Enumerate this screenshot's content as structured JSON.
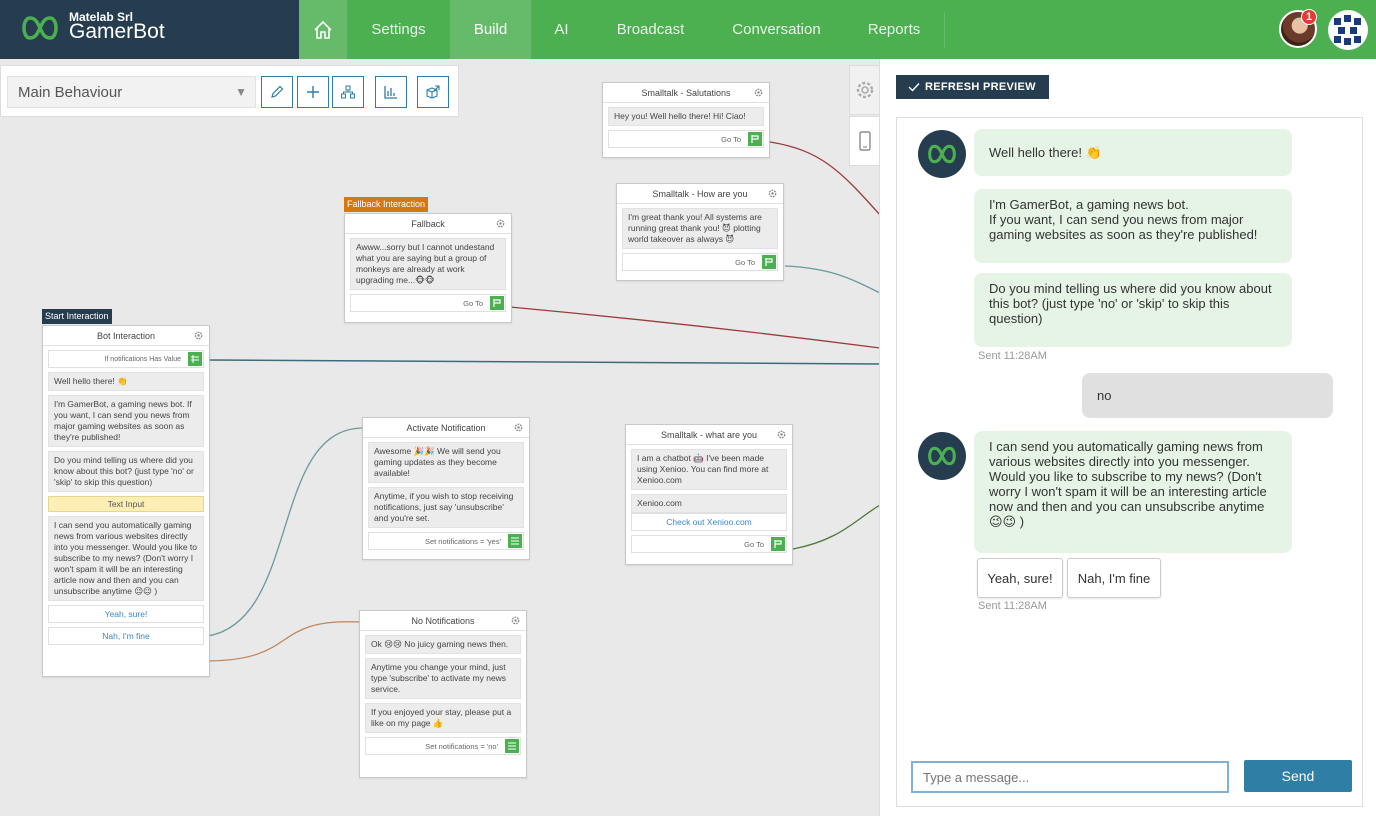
{
  "brand": {
    "company": "Matelab Srl",
    "name": "GamerBot"
  },
  "nav": {
    "items": [
      {
        "label": "Settings"
      },
      {
        "label": "Build"
      },
      {
        "label": "AI"
      },
      {
        "label": "Broadcast"
      },
      {
        "label": "Conversation"
      },
      {
        "label": "Reports"
      }
    ],
    "active": "Build",
    "notification_count": "1"
  },
  "toolbar": {
    "behaviour": "Main Behaviour"
  },
  "colors": {
    "accent_green": "#4caf50",
    "dark_navy": "#263d4f",
    "link_blue": "#2e7ea6"
  },
  "nodes": {
    "start": {
      "tag": "Start Interaction",
      "title": "Bot Interaction",
      "condition": "If notifications Has Value",
      "messages": [
        "Well hello there! 👏",
        "I'm GamerBot, a gaming news bot. If you want, I can send you news from major gaming websites as soon as they're published!",
        "Do you mind telling us where did you know about this bot? (just type 'no' or 'skip' to skip this question)"
      ],
      "text_input": "Text Input",
      "subscribe_message": "I can send you automatically gaming news from various websites directly into you messenger. Would you like to subscribe to my news? (Don't worry I won't spam it will be an interesting article now and then and you can unsubscribe anytime 😉😉 )",
      "button_yes": "Yeah, sure!",
      "button_no": "Nah, I'm fine"
    },
    "fallback": {
      "tag": "Fallback Interaction",
      "title": "Fallback",
      "message": "Awww...sorry but I cannot undestand what you are saying but a group of monkeys are already at work upgrading me...🐵🐵",
      "goto": "Go To"
    },
    "salutations": {
      "title": "Smalltalk - Salutations",
      "message": "Hey you! Well hello there! Hi! Ciao!",
      "goto": "Go To"
    },
    "how_are_you": {
      "title": "Smalltalk - How are you",
      "message": "I'm great thank you! All systems are running great thank you! 😈 plotting world takeover as always 😈",
      "goto": "Go To"
    },
    "activate": {
      "title": "Activate Notification",
      "message1": "Awesome 🎉🎉 We will send you gaming updates as they become available!",
      "message2": "Anytime, if you wish to stop receiving notifications, just say 'unsubscribe' and you're set.",
      "set": "Set notifications = 'yes'"
    },
    "what_are_you": {
      "title": "Smalltalk - what are you",
      "message": "I am a chatbot 🤖 I've been made using Xenioo. You can find more at Xenioo.com",
      "card_text": "Xenioo.com",
      "card_link": "Check out Xenioo.com",
      "goto": "Go To"
    },
    "no_notifications": {
      "title": "No Notifications",
      "message1": "Ok 😢😢 No juicy gaming news then.",
      "message2": "Anytime you change your mind, just type 'subscribe' to activate my news service.",
      "message3": "If you enjoyed your stay, please put a like on my page 👍",
      "set": "Set notifications = 'no'"
    }
  },
  "preview": {
    "refresh_label": "REFRESH PREVIEW",
    "messages": {
      "m1": "Well hello there! 👏",
      "m2": "I'm GamerBot, a gaming news bot.\nIf you want, I can send you news from major gaming websites as soon as they're published!",
      "m3": "Do you mind telling us where did you know about this bot? (just type 'no' or 'skip' to skip this question)",
      "time1": "Sent 11:28AM",
      "user1": "no",
      "m4": "I can send you automatically gaming news from various websites directly into you messenger. Would you like to subscribe to my news? (Don't worry I won't spam it will be an interesting article now and then and you can unsubscribe anytime 😉😉 )",
      "time2": "Sent 11:28AM"
    },
    "quick_replies": {
      "yes": "Yeah, sure!",
      "no": "Nah, I'm fine"
    },
    "input_placeholder": "Type a message...",
    "send_label": "Send"
  }
}
